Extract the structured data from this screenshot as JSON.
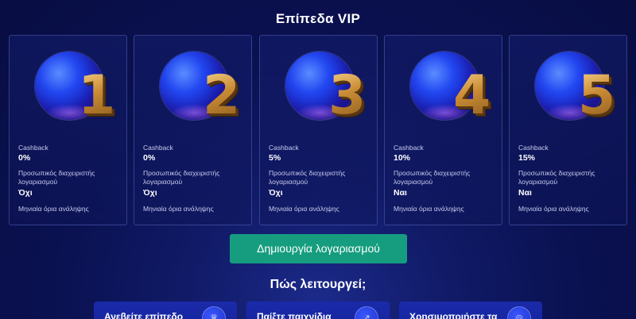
{
  "page": {
    "title": "Επίπεδα VIP"
  },
  "levels": [
    {
      "number": "1",
      "cashback_label": "Cashback",
      "cashback": "0%",
      "manager_label": "Προσωπικός διαχειριστής λογαριασμού",
      "manager": "Όχι",
      "limits_label": "Μηνιαία όρια ανάληψης"
    },
    {
      "number": "2",
      "cashback_label": "Cashback",
      "cashback": "0%",
      "manager_label": "Προσωπικός διαχειριστής λογαριασμού",
      "manager": "Όχι",
      "limits_label": "Μηνιαία όρια ανάληψης"
    },
    {
      "number": "3",
      "cashback_label": "Cashback",
      "cashback": "5%",
      "manager_label": "Προσωπικός διαχειριστής λογαριασμού",
      "manager": "Όχι",
      "limits_label": "Μηνιαία όρια ανάληψης"
    },
    {
      "number": "4",
      "cashback_label": "Cashback",
      "cashback": "10%",
      "manager_label": "Προσωπικός διαχειριστής λογαριασμού",
      "manager": "Ναι",
      "limits_label": "Μηνιαία όρια ανάληψης"
    },
    {
      "number": "5",
      "cashback_label": "Cashback",
      "cashback": "15%",
      "manager_label": "Προσωπικός διαχειριστής λογαριασμού",
      "manager": "Ναι",
      "limits_label": "Μηνιαία όρια ανάληψης"
    }
  ],
  "cta": {
    "label": "Δημιουργία λογαριασμού"
  },
  "how_it_works": {
    "title": "Πώς λειτουργεί;",
    "steps": [
      {
        "label": "Ανεβείτε επίπεδο",
        "icon": "crown-icon",
        "glyph": "♛"
      },
      {
        "label": "Παίξτε παιχνίδια",
        "icon": "arrow-icon",
        "glyph": "↗"
      },
      {
        "label": "Χρησιμοποιήστε τα",
        "icon": "coin-icon",
        "glyph": "◎"
      }
    ]
  },
  "colors": {
    "background": "#0a1150",
    "cta": "#169d7f",
    "number_gold": "#c98f3a"
  }
}
